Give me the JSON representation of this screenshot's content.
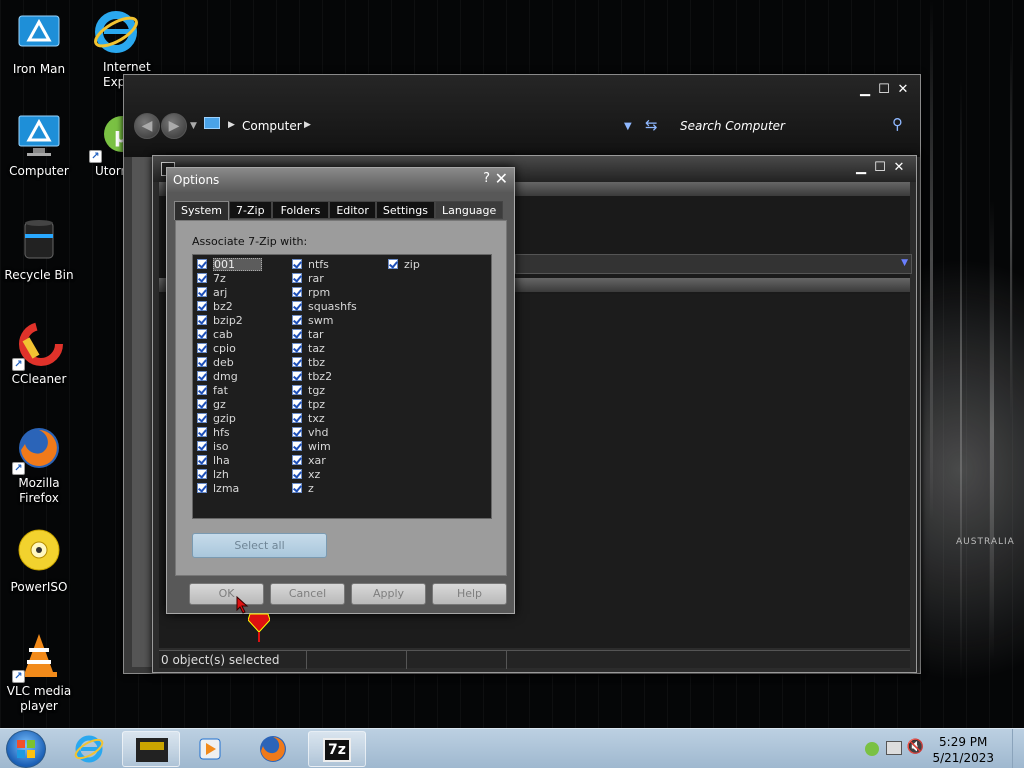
{
  "desktop": {
    "icons": [
      {
        "label": "Iron Man",
        "icon": "iron-man-icon"
      },
      {
        "label": "Internet Explo",
        "icon": "internet-explorer-icon"
      },
      {
        "label": "Computer",
        "icon": "computer-icon"
      },
      {
        "label": "Utorr",
        "icon": "utorrent-icon"
      },
      {
        "label": "Recycle Bin",
        "icon": "recycle-bin-icon"
      },
      {
        "label": "CCleaner",
        "icon": "ccleaner-icon"
      },
      {
        "label": "Mozilla Firefox",
        "icon": "firefox-icon"
      },
      {
        "label": "PowerISO",
        "icon": "poweriso-icon"
      },
      {
        "label": "VLC media player",
        "icon": "vlc-icon"
      }
    ],
    "wallpaper_text": "AUSTRALIA"
  },
  "explorer": {
    "breadcrumb": "Computer",
    "search_placeholder": "Search Computer"
  },
  "fm": {
    "status": "0 object(s) selected"
  },
  "options": {
    "title": "Options",
    "help": "?",
    "close": "✕",
    "tabs": [
      "System",
      "7-Zip",
      "Folders",
      "Editor",
      "Settings",
      "Language"
    ],
    "active_tab": "System",
    "caption": "Associate 7-Zip with:",
    "col1": [
      "001",
      "7z",
      "arj",
      "bz2",
      "bzip2",
      "cab",
      "cpio",
      "deb",
      "dmg",
      "fat",
      "gz",
      "gzip",
      "hfs",
      "iso",
      "lha",
      "lzh",
      "lzma"
    ],
    "col2": [
      "ntfs",
      "rar",
      "rpm",
      "squashfs",
      "swm",
      "tar",
      "taz",
      "tbz",
      "tbz2",
      "tgz",
      "tpz",
      "txz",
      "vhd",
      "wim",
      "xar",
      "xz",
      "z"
    ],
    "col3": [
      "zip"
    ],
    "select_all": "Select all",
    "buttons": {
      "ok": "OK",
      "cancel": "Cancel",
      "apply": "Apply",
      "help": "Help"
    }
  },
  "taskbar": {
    "items": [
      "internet-explorer-icon",
      "cinema-icon",
      "media-player-icon",
      "firefox-icon",
      "7zip-icon"
    ],
    "clock_time": "5:29 PM",
    "clock_date": "5/21/2023",
    "zip_label": "7z"
  }
}
